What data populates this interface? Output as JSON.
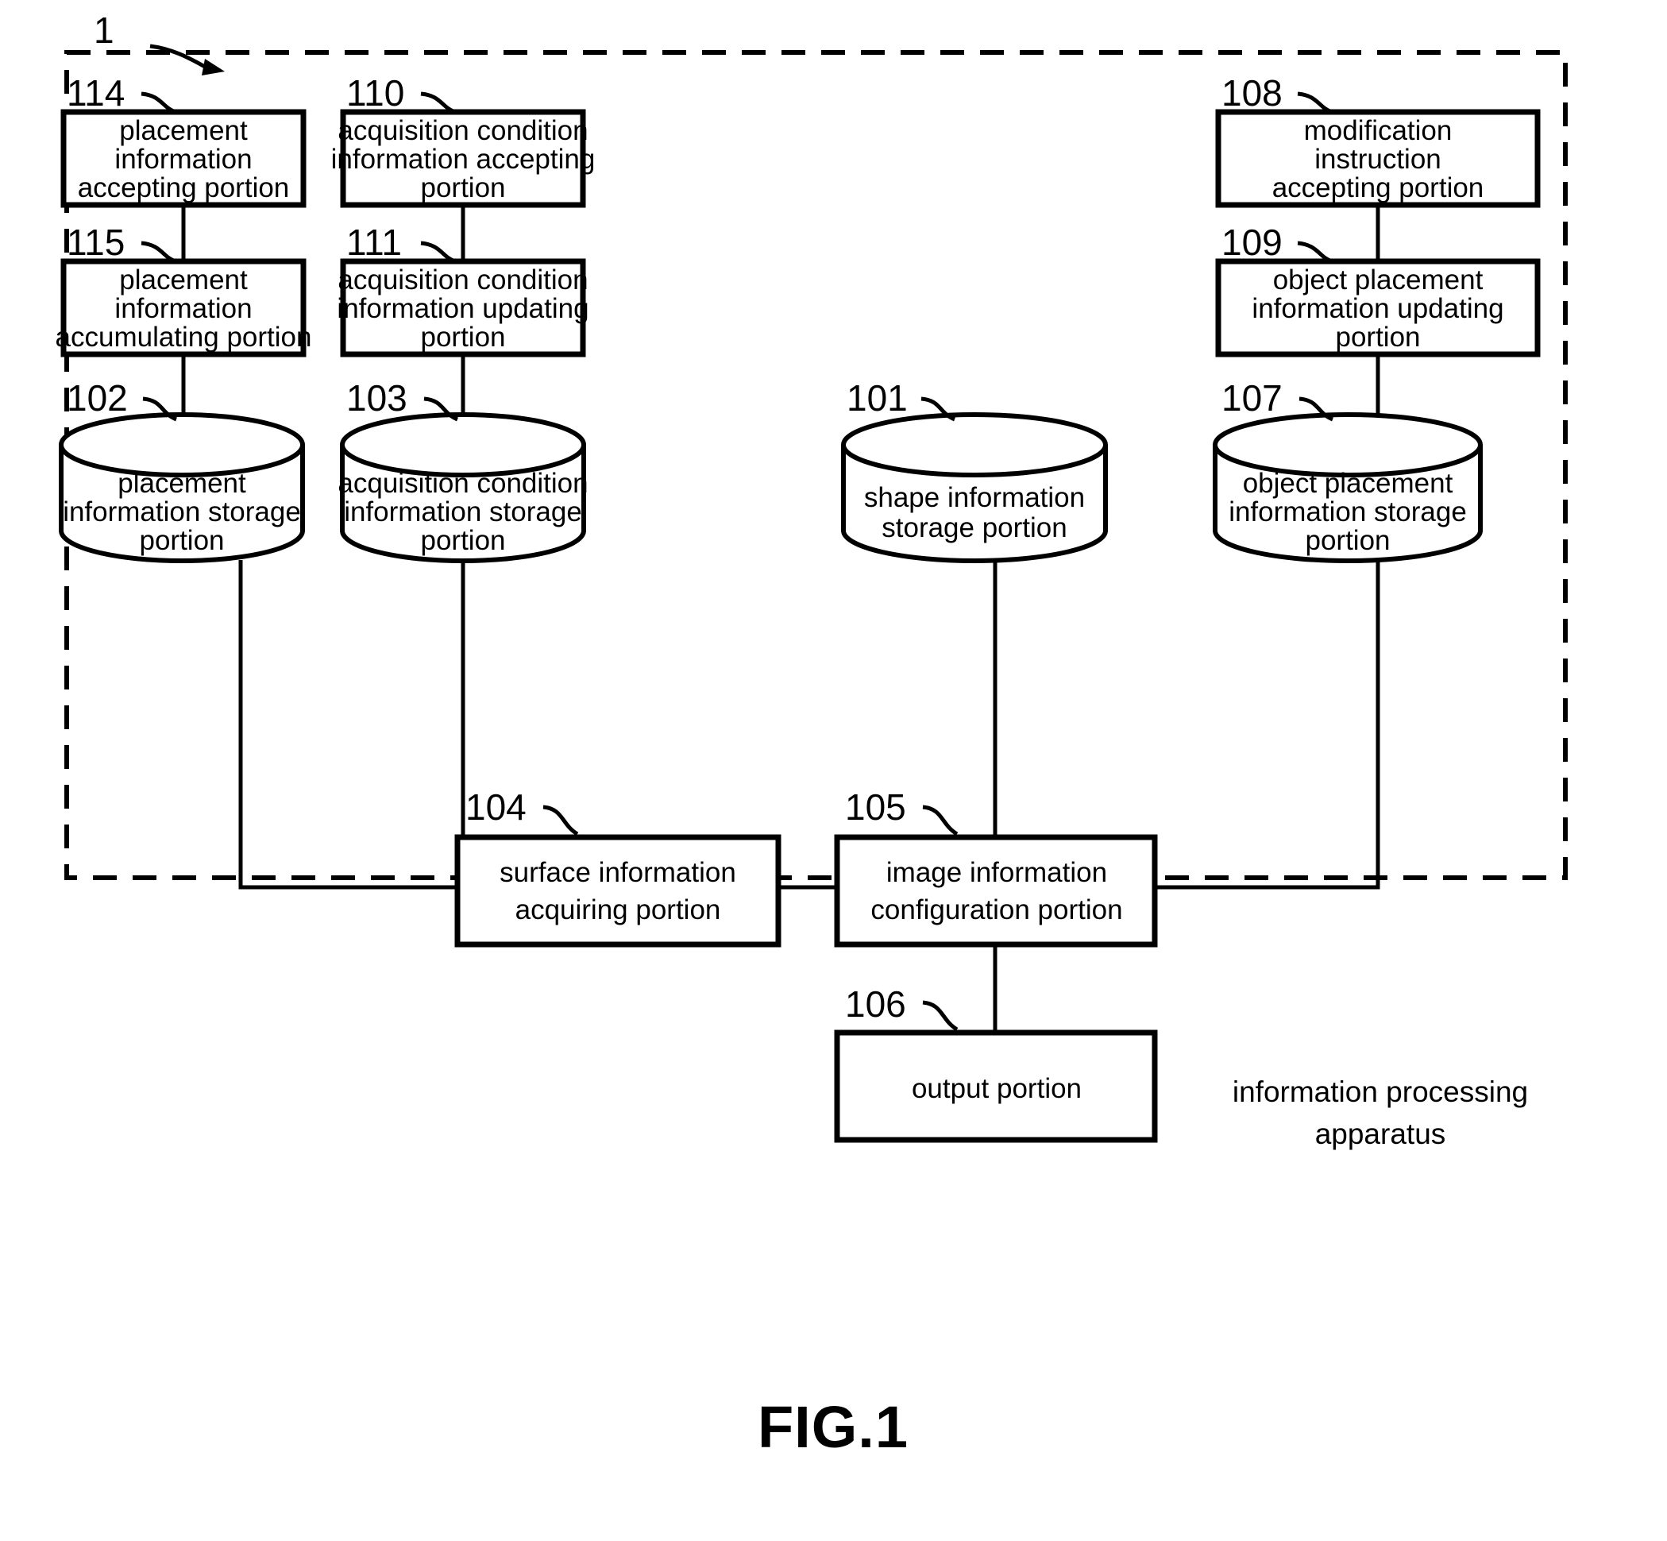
{
  "figure": {
    "caption": "FIG.1",
    "system_ref": "1",
    "apparatus_label_line1": "information processing",
    "apparatus_label_line2": "apparatus"
  },
  "boxes": [
    {
      "ref": "114",
      "name": "placement-information-accepting-portion",
      "lines": [
        "placement",
        "information",
        "accepting portion"
      ]
    },
    {
      "ref": "115",
      "name": "placement-information-accumulating-portion",
      "lines": [
        "placement",
        "information",
        "accumulating portion"
      ]
    },
    {
      "ref": "110",
      "name": "acquisition-condition-information-accepting-portion",
      "lines": [
        "acquisition condition",
        "information accepting",
        "portion"
      ]
    },
    {
      "ref": "111",
      "name": "acquisition-condition-information-updating-portion",
      "lines": [
        "acquisition condition",
        "information updating",
        "portion"
      ]
    },
    {
      "ref": "108",
      "name": "modification-instruction-accepting-portion",
      "lines": [
        "modification",
        "instruction",
        "accepting portion"
      ]
    },
    {
      "ref": "109",
      "name": "object-placement-information-updating-portion",
      "lines": [
        "object placement",
        "information updating",
        "portion"
      ]
    },
    {
      "ref": "104",
      "name": "surface-information-acquiring-portion",
      "lines": [
        "surface information",
        "acquiring portion"
      ]
    },
    {
      "ref": "105",
      "name": "image-information-configuration-portion",
      "lines": [
        "image information",
        "configuration portion"
      ]
    },
    {
      "ref": "106",
      "name": "output-portion",
      "lines": [
        "output portion"
      ]
    }
  ],
  "cylinders": [
    {
      "ref": "102",
      "name": "placement-information-storage-portion",
      "lines": [
        "placement",
        "information storage",
        "portion"
      ]
    },
    {
      "ref": "103",
      "name": "acquisition-condition-information-storage-portion",
      "lines": [
        "acquisition condition",
        "information storage",
        "portion"
      ]
    },
    {
      "ref": "101",
      "name": "shape-information-storage-portion",
      "lines": [
        "shape information",
        "storage portion"
      ]
    },
    {
      "ref": "107",
      "name": "object-placement-information-storage-portion",
      "lines": [
        "object placement",
        "information storage",
        "portion"
      ]
    }
  ]
}
